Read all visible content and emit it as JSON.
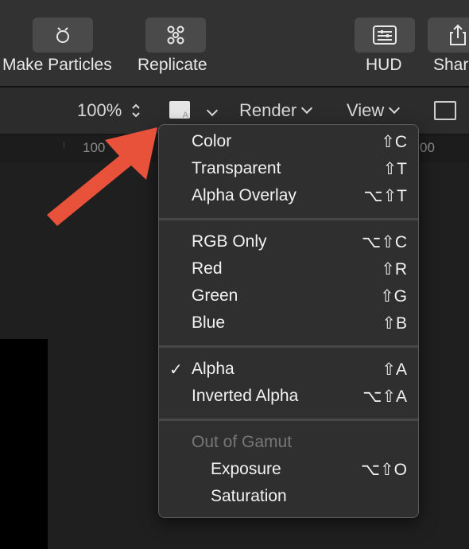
{
  "toolbar": {
    "buttons": [
      {
        "label": "Make Particles",
        "icon": "particles-icon"
      },
      {
        "label": "Replicate",
        "icon": "replicate-icon"
      },
      {
        "label": "HUD",
        "icon": "hud-icon"
      },
      {
        "label": "Shar",
        "icon": "share-icon"
      }
    ]
  },
  "viewbar": {
    "zoom": "100%",
    "channel_swatch_letter": "A",
    "render": "Render",
    "view": "View"
  },
  "ruler": {
    "left_label": "100",
    "right_label": "00"
  },
  "menu": {
    "items": [
      {
        "label": "Color",
        "shortcut": "⇧C"
      },
      {
        "label": "Transparent",
        "shortcut": "⇧T"
      },
      {
        "label": "Alpha Overlay",
        "shortcut": "⌥⇧T"
      },
      {
        "label": "RGB Only",
        "shortcut": "⌥⇧C"
      },
      {
        "label": "Red",
        "shortcut": "⇧R"
      },
      {
        "label": "Green",
        "shortcut": "⇧G"
      },
      {
        "label": "Blue",
        "shortcut": "⇧B"
      },
      {
        "label": "Alpha",
        "shortcut": "⇧A",
        "checked": true,
        "check_glyph": "✓"
      },
      {
        "label": "Inverted Alpha",
        "shortcut": "⌥⇧A"
      },
      {
        "label": "Out of Gamut",
        "disabled": true
      },
      {
        "label": "Exposure",
        "shortcut": "⌥⇧O"
      },
      {
        "label": "Saturation",
        "shortcut": ""
      }
    ]
  },
  "annotation": {
    "arrow_color": "#e8523a"
  }
}
